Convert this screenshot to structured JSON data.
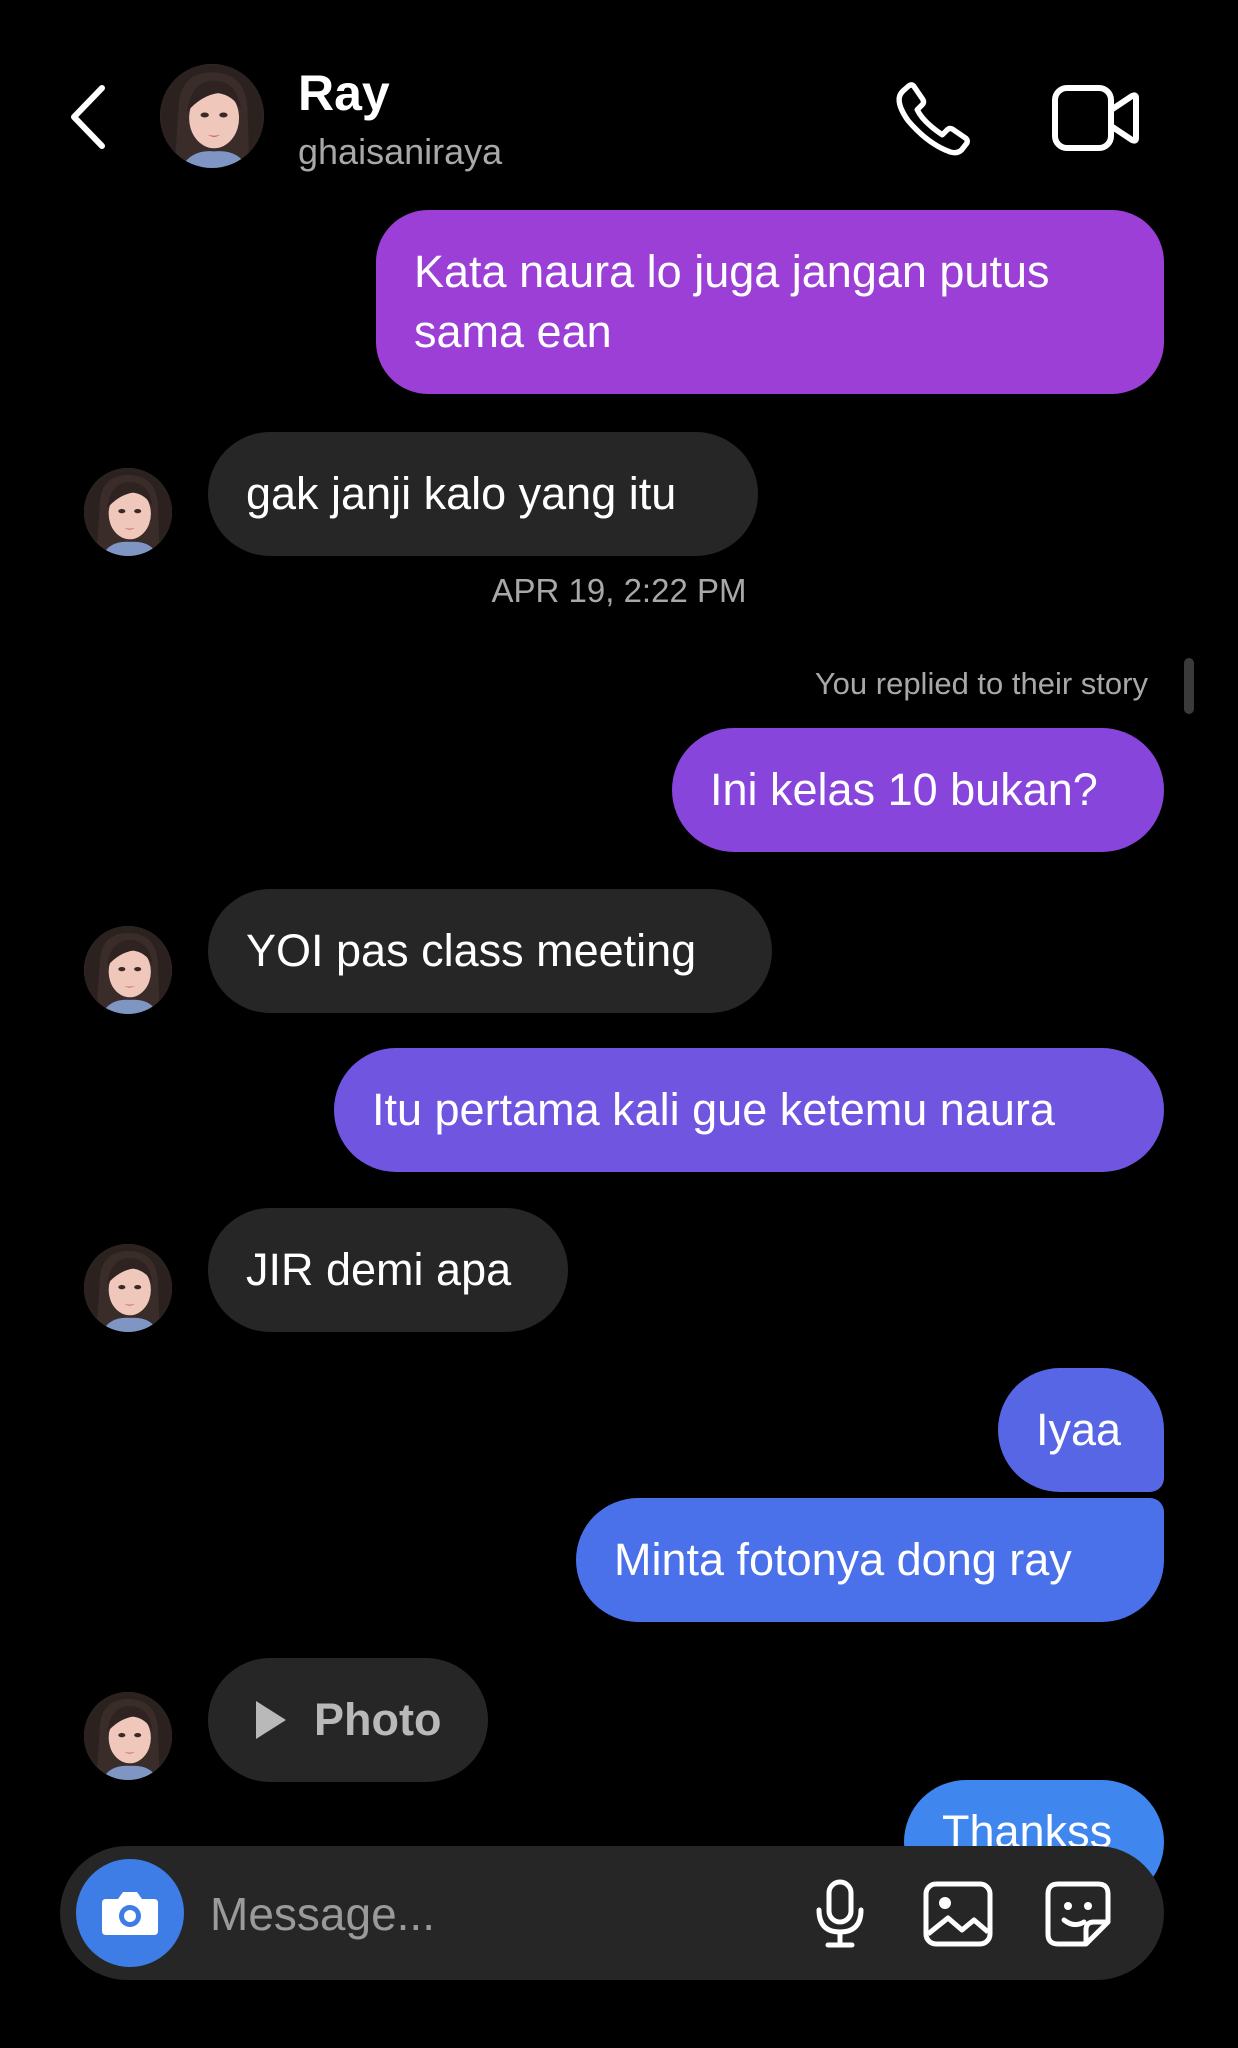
{
  "header": {
    "name": "Ray",
    "username": "ghaisaniraya",
    "icons": [
      "back-icon",
      "phone-icon",
      "video-camera-icon"
    ]
  },
  "messages": [
    {
      "id": "m1",
      "side": "out",
      "lines": [
        "Kata naura lo juga jangan putus",
        "sama ean"
      ],
      "color": "#9b3fd6"
    },
    {
      "id": "m2",
      "side": "in",
      "text": "gak janji kalo yang itu"
    },
    {
      "id": "m3",
      "side": "out",
      "text": "Ini kelas 10 bukan?",
      "color": "#8845dc"
    },
    {
      "id": "m4",
      "side": "in",
      "text": "YOI pas class meeting"
    },
    {
      "id": "m5",
      "side": "out",
      "text": "Itu pertama kali gue ketemu naura",
      "color": "#7055e0"
    },
    {
      "id": "m6",
      "side": "in",
      "text": "JIR demi apa"
    },
    {
      "id": "m7",
      "side": "out",
      "text": "Iyaa",
      "color": "#5766e5"
    },
    {
      "id": "m8",
      "side": "out",
      "text": "Minta fotonya dong ray",
      "color": "#4a70ea"
    },
    {
      "id": "m9",
      "side": "in",
      "text": "Photo",
      "icon": "play-icon"
    },
    {
      "id": "m10",
      "side": "out",
      "text": "Thankss",
      "color": "#3f86ee"
    }
  ],
  "timestamp": "APR 19, 2:22 PM",
  "story_note": "You replied to their story",
  "composer": {
    "placeholder": "Message...",
    "icons": [
      "camera-icon",
      "microphone-icon",
      "gallery-icon",
      "sticker-icon"
    ],
    "camera_color": "#3d7de5"
  }
}
